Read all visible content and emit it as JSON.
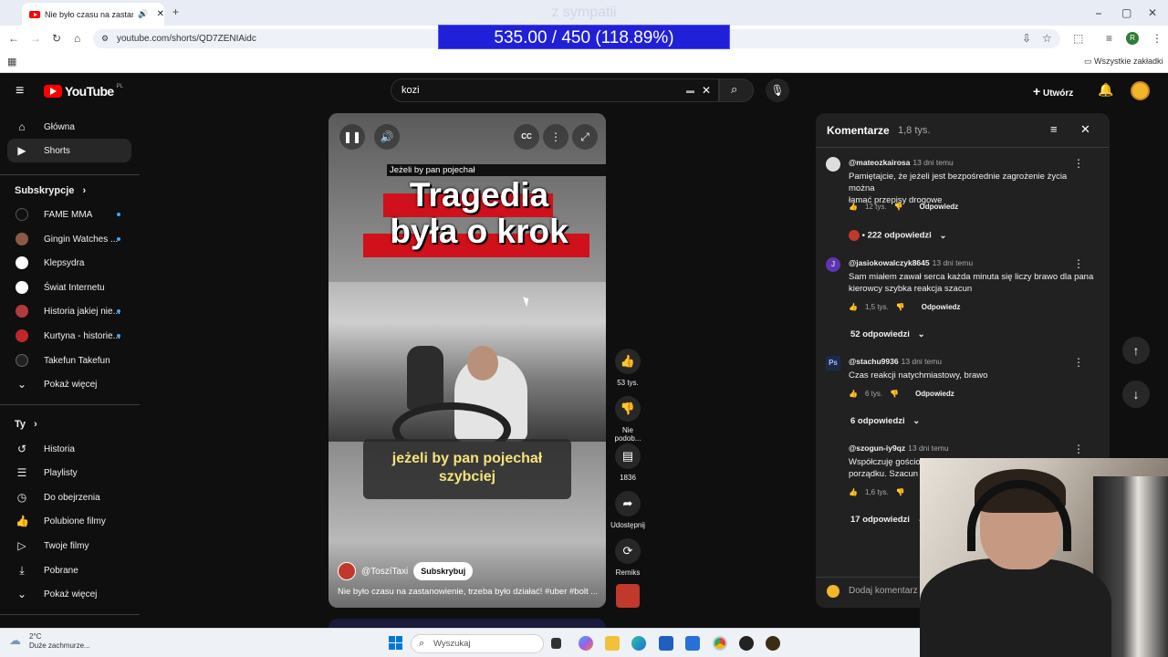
{
  "browser": {
    "tab_title": "Nie było czasu na zastanow",
    "url": "youtube.com/shorts/QD7ZENIAidc",
    "bookmarks_label": "Wszystkie zakładki",
    "profile_initial": "R"
  },
  "overlay": {
    "label": "z sympatii",
    "score": "535.00 / 450 (118.89%)"
  },
  "masthead": {
    "logo": "YouTube",
    "logo_region": "PL",
    "search_value": "kozi",
    "create_label": "Utwórz"
  },
  "sidebar": {
    "main": [
      {
        "label": "Główna",
        "icon": "home-icon"
      },
      {
        "label": "Shorts",
        "icon": "shorts-icon"
      }
    ],
    "subscriptions_header": "Subskrypcje",
    "subscriptions": [
      {
        "label": "FAME MMA",
        "color": "#111111",
        "new": true
      },
      {
        "label": "Gingin Watches ...",
        "color": "#8a5a44",
        "new": true
      },
      {
        "label": "Klepsydra",
        "color": "#ffffff",
        "new": false
      },
      {
        "label": "Świat Internetu",
        "color": "#ffffff",
        "new": false
      },
      {
        "label": "Historia jakiej nie...",
        "color": "#b23a3a",
        "new": true
      },
      {
        "label": "Kurtyna - historie...",
        "color": "#c2262a",
        "new": true
      },
      {
        "label": "Takefun Takefun",
        "color": "#222222",
        "new": false
      }
    ],
    "show_more": "Pokaż więcej",
    "you_header": "Ty",
    "you_items": [
      {
        "label": "Historia",
        "icon": "history-icon"
      },
      {
        "label": "Playlisty",
        "icon": "playlist-icon"
      },
      {
        "label": "Do obejrzenia",
        "icon": "clock-icon"
      },
      {
        "label": "Polubione filmy",
        "icon": "like-icon"
      },
      {
        "label": "Twoje filmy",
        "icon": "video-icon"
      },
      {
        "label": "Pobrane",
        "icon": "download-icon"
      }
    ],
    "you_show_more": "Pokaż więcej"
  },
  "video": {
    "headline_small": "Jeżeli by pan pojechał",
    "headline_line1": "Tragedia",
    "headline_line2": "była o krok",
    "caption_line1": "jeżeli by pan pojechał",
    "caption_line2": "szybciej",
    "channel": "@ToszíTaxi",
    "subscribe": "Subskrybuj",
    "title": "Nie było czasu na zastanowienie, trzeba było działać! #uber #bolt ..."
  },
  "actions": {
    "likes": "53 tys.",
    "dislike": "Nie podob...",
    "comments": "1836",
    "share": "Udostępnij",
    "remix": "Remiks"
  },
  "comments": {
    "title": "Komentarze",
    "count": "1,8 tys.",
    "reply_label": "Odpowiedz",
    "add_placeholder": "Dodaj komentarz",
    "items": [
      {
        "author": "@mateozkairosa",
        "time": "13 dni temu",
        "line1": "Pamiętajcie, że jeżeli jest bezpośrednie zagrożenie życia można",
        "line2": "łamać przepisy drogowe",
        "likes": "12 tys.",
        "replies": "• 222 odpowiedzi",
        "avatar_color": "#dddddd"
      },
      {
        "author": "@jasiokowalczyk8645",
        "time": "13 dni temu",
        "line1": "Sam miałem zawał serca każda minuta się liczy brawo dla pana",
        "line2": "kierowcy szybka reakcja szacun",
        "likes": "1,5 tys.",
        "replies": "52 odpowiedzi",
        "avatar_color": "#5e35b1"
      },
      {
        "author": "@stachu9936",
        "time": "13 dni temu",
        "line1": "Czas reakcji natychmiastowy, brawo",
        "line2": "",
        "likes": "6 tys.",
        "replies": "6 odpowiedzi",
        "avatar_color": "#1c2a4a"
      },
      {
        "author": "@szogun-iy9qz",
        "time": "13 dni temu",
        "line1": "Współczuję gościo",
        "line2": "porządku. Szacun z",
        "likes": "1,6 tys.",
        "replies": "17 odpowiedzi",
        "avatar_color": "#212121"
      }
    ]
  },
  "taskbar": {
    "temperature": "2°C",
    "weather": "Duże zachmurze...",
    "search": "Wyszukaj"
  }
}
